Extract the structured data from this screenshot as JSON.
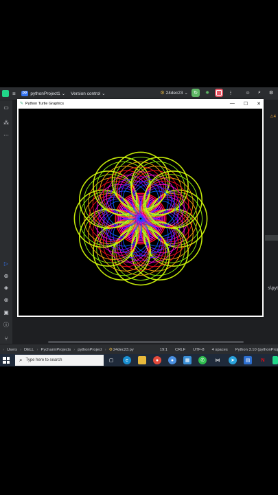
{
  "ide": {
    "project_name": "pythonProject1",
    "project_initials": "PP",
    "project_chevron": "⌄",
    "version_control": "Version control",
    "version_chevron": "⌄",
    "run_config": "24dec23",
    "run_chevron": "⌄",
    "right_hint": "⚠4",
    "right_path": "s\\pyt"
  },
  "turtle_window": {
    "title": "Python Turtle Graphics",
    "minimize": "—",
    "maximize": "☐",
    "close": "✕"
  },
  "breadcrumb": {
    "items": [
      "Users",
      "DELL",
      "PycharmProjects",
      "pythonProject",
      "24dec23.py"
    ],
    "separator": "›",
    "lead": "›"
  },
  "status": {
    "position": "19:1",
    "line_sep": "CRLF",
    "encoding": "UTF-8",
    "indent": "4 spaces",
    "interpreter": "Python 3.10 (pythonProj"
  },
  "taskbar": {
    "search_placeholder": "Type here to search"
  },
  "colors": {
    "ide_bg": "#2b2d30",
    "accent": "#3574f0",
    "run_green": "#5fb865",
    "stop_red": "#e55765",
    "taskbar": "#1f2a3a"
  },
  "icons": [
    "jetbrains-icon",
    "folder-icon",
    "structure-icon",
    "more-icon",
    "play-icon",
    "debug-icon",
    "stop-icon",
    "user-icon",
    "search-icon",
    "settings-icon",
    "edge-icon",
    "file-explorer-icon",
    "chrome-icon",
    "store-icon",
    "whatsapp-icon",
    "telegram-icon",
    "netflix-icon"
  ]
}
